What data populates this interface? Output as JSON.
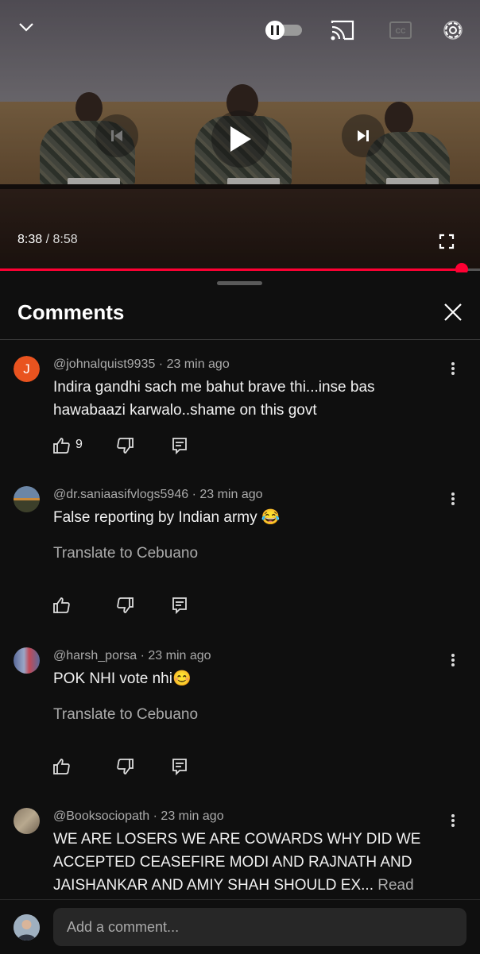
{
  "player": {
    "current_time": "8:38",
    "duration": "8:58",
    "separator": " / ",
    "progress_fraction": 0.962,
    "accent_color": "#ff0033"
  },
  "comments_panel": {
    "title": "Comments",
    "comments": [
      {
        "author": "@johnalquist9935",
        "age": "23 min ago",
        "avatar_letter": "J",
        "avatar_color": "#e9531f",
        "text": "Indira gandhi sach me bahut brave thi...inse bas hawabaazi karwalo..shame on this govt",
        "like_count": "9"
      },
      {
        "author": "@dr.saniaasifvlogs5946",
        "age": "23 min ago",
        "text": "False reporting by Indian army 😂",
        "translate": "Translate to Cebuano"
      },
      {
        "author": "@harsh_porsa",
        "age": "23 min ago",
        "text": "POK NHI vote nhi😊",
        "translate": "Translate to Cebuano"
      },
      {
        "author": "@Booksociopath",
        "age": "23 min ago",
        "text": "WE ARE LOSERS WE ARE COWARDS WHY DID WE ACCEPTED CEASEFIRE MODI AND RAJNATH AND JAISHANKAR AND AMIY SHAH SHOULD EX...",
        "read_more": "Read more"
      }
    ]
  },
  "composer": {
    "placeholder": "Add a comment..."
  },
  "icons": [
    "chevron-down-icon",
    "autoplay-toggle-icon",
    "cast-icon",
    "captions-icon",
    "settings-gear-icon",
    "previous-icon",
    "play-icon",
    "next-icon",
    "fullscreen-icon",
    "close-icon",
    "more-vert-icon",
    "thumb-up-icon",
    "thumb-down-icon",
    "reply-icon"
  ]
}
